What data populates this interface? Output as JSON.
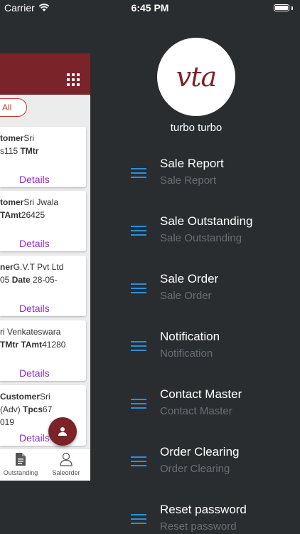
{
  "status_bar": {
    "carrier": "Carrier",
    "time": "6:45 PM"
  },
  "background_screen": {
    "filter_button": "All",
    "cards": [
      {
        "line1_bold": "tomer",
        "line1": "Sri",
        "line2": "s115 ",
        "line2_bold": "TMtr",
        "details": "Details"
      },
      {
        "line1_bold": "tomer",
        "line1": "Sri Jwala",
        "line2": "",
        "line2_bold": "TAmt",
        "line2_tail": "26425",
        "details": "Details"
      },
      {
        "line1_bold": "ner",
        "line1": "G.V.T Pvt Ltd",
        "line2": "05 ",
        "line2_bold": "Date",
        "line2_tail": "28-05-",
        "details": "Details"
      },
      {
        "line1_bold": "",
        "line1": "ri Venkateswara",
        "line2": "",
        "line2_bold": "TMtr TAmt",
        "line2_tail": "41280",
        "details": "Details"
      },
      {
        "line1_bold": "Customer",
        "line1": "Sri",
        "line2": "(Adv) ",
        "line2_bold": "Tpcs",
        "line2_tail": "67",
        "line3": "019",
        "details": "Details"
      }
    ],
    "bottom_nav": [
      {
        "label": "Outstanding",
        "icon": "document-icon"
      },
      {
        "label": "Saleorder",
        "icon": "user-outline-icon"
      }
    ]
  },
  "drawer": {
    "logo_text": "vta",
    "username": "turbo turbo",
    "menu": [
      {
        "title": "Sale Report",
        "subtitle": "Sale Report"
      },
      {
        "title": "Sale Outstanding",
        "subtitle": "Sale Outstanding"
      },
      {
        "title": "Sale Order",
        "subtitle": "Sale Order"
      },
      {
        "title": "Notification",
        "subtitle": "Notification"
      },
      {
        "title": "Contact Master",
        "subtitle": "Contact Master"
      },
      {
        "title": "Order Clearing",
        "subtitle": "Order Clearing"
      },
      {
        "title": "Reset password",
        "subtitle": "Reset password"
      }
    ]
  },
  "colors": {
    "brand": "#7a2329",
    "drawer_bg": "#2a2d30",
    "menu_icon": "#2d8fd6",
    "link": "#8b2fc9"
  }
}
